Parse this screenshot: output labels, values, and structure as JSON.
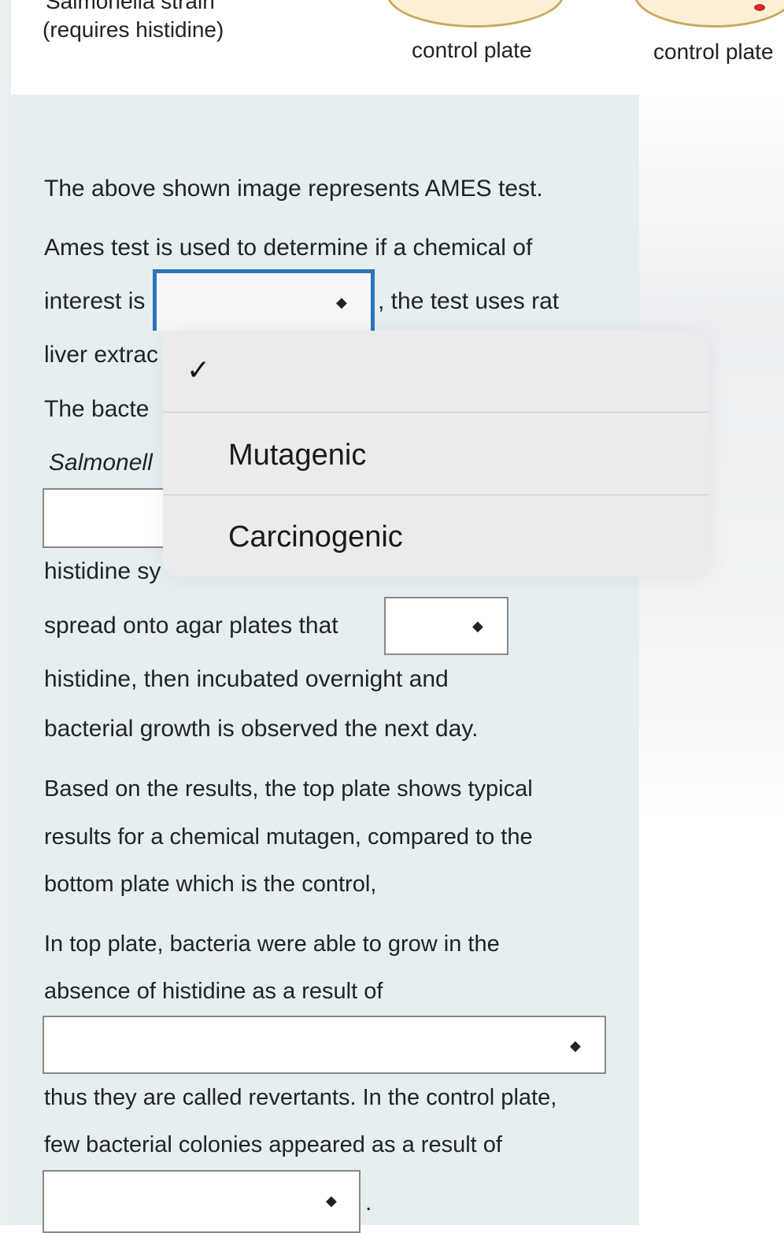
{
  "figure": {
    "strain_cut_label": "Salmonella strain",
    "requires_label": "(requires histidine)",
    "plate_label_1": "control plate",
    "plate_label_2": "control plate"
  },
  "question": {
    "p1": "The above shown image represents AMES test.",
    "p2": "Ames test is used to determine if a chemical of",
    "p3_before": "interest is",
    "p3_after": ", the test uses rat",
    "p4": "liver extrac",
    "p5": "The bacte",
    "p6": "Salmonell",
    "p8": "histidine sy",
    "p9": "spread onto agar plates that",
    "p10": "histidine, then incubated overnight and",
    "p11": "bacterial growth is observed the next day.",
    "p12": "Based on the results, the top plate shows typical",
    "p13": "results for a chemical mutagen, compared to the",
    "p14": "bottom plate which is the control,",
    "p15": "In top plate, bacteria were able to grow in the",
    "p16": "absence of histidine as a result of",
    "p17": "thus they are called revertants. In the control plate,",
    "p18": "few bacterial colonies appeared as a result of",
    "period": "."
  },
  "dropdown": {
    "selected": "",
    "checkmark": "✓",
    "options": [
      "Mutagenic",
      "Carcinogenic"
    ]
  },
  "icons": {
    "updown": "updown-arrows-icon"
  }
}
